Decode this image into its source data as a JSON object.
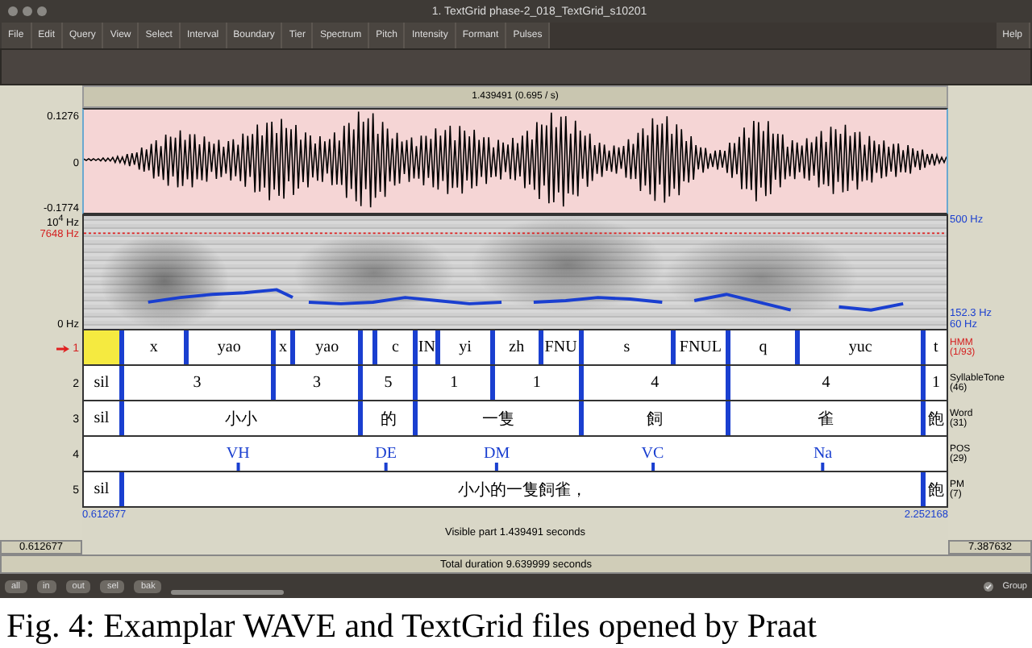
{
  "window": {
    "title": "1. TextGrid phase-2_018_TextGrid_s10201"
  },
  "menu": [
    "File",
    "Edit",
    "Query",
    "View",
    "Select",
    "Interval",
    "Boundary",
    "Tier",
    "Spectrum",
    "Pitch",
    "Intensity",
    "Formant",
    "Pulses"
  ],
  "help": "Help",
  "selection_duration": "1.439491 (0.695 / s)",
  "waveform": {
    "max": "0.1276",
    "zero": "0",
    "min": "-0.1774"
  },
  "spectrogram": {
    "top": "10$^{4}$ Hz",
    "cursor": "7648 Hz",
    "bottom": "0 Hz",
    "pitch_top": "500 Hz",
    "pitch_value": "152.3 Hz",
    "pitch_bottom": "60 Hz"
  },
  "tiers": [
    {
      "number": "1",
      "selected": true,
      "name": "HMM",
      "count": "(1/93)",
      "kind": "interval",
      "items": [
        {
          "selected": true
        },
        {
          "text": "x",
          "selected": false
        },
        {
          "text": "yao",
          "selected": false
        },
        {
          "text": "x",
          "selected": false
        },
        {
          "text": "yao",
          "selected": false
        },
        {
          "selected": false
        },
        {
          "text": "c",
          "selected": false
        },
        {
          "text": "IN",
          "selected": false
        },
        {
          "text": "yi",
          "selected": false
        },
        {
          "text": "zh",
          "selected": false
        },
        {
          "text": "FNU",
          "selected": false
        },
        {
          "text": "s",
          "selected": false
        },
        {
          "text": "FNUL",
          "selected": false
        },
        {
          "text": "q",
          "selected": false
        },
        {
          "text": "yuc",
          "selected": false
        },
        {
          "text": "t",
          "selected": false
        }
      ]
    },
    {
      "number": "2",
      "selected": false,
      "name": "SyllableTone",
      "count": "(46)",
      "kind": "interval",
      "items": [
        {
          "text": "sil"
        },
        {
          "text": "3"
        },
        {
          "text": "3"
        },
        {
          "text": "5"
        },
        {
          "text": "1"
        },
        {
          "text": "1"
        },
        {
          "text": "4"
        },
        {
          "text": "4"
        },
        {
          "text": "1"
        }
      ]
    },
    {
      "number": "3",
      "selected": false,
      "name": "Word",
      "count": "(31)",
      "kind": "interval",
      "items": [
        {
          "text": "sil"
        },
        {
          "text": "小小"
        },
        {
          "text": "的"
        },
        {
          "text": "一隻"
        },
        {
          "text": "飼"
        },
        {
          "text": "雀"
        },
        {
          "text": "飽"
        }
      ]
    },
    {
      "number": "4",
      "selected": false,
      "name": "POS",
      "count": "(29)",
      "kind": "point",
      "items": [
        {
          "text": "VH"
        },
        {
          "text": "DE"
        },
        {
          "text": "DM"
        },
        {
          "text": "VC"
        },
        {
          "text": "Na"
        }
      ]
    },
    {
      "number": "5",
      "selected": false,
      "name": "PM",
      "count": "(7)",
      "kind": "interval",
      "items": [
        {
          "text": "sil"
        },
        {
          "text": "小小的一隻飼雀，"
        },
        {
          "text": "飽"
        }
      ]
    }
  ],
  "visible": {
    "window_start": "0.612677",
    "start": "0.612677",
    "label": "Visible part 1.439491 seconds",
    "end": "2.252168",
    "window_end": "7.387632"
  },
  "total": "Total duration 9.639999 seconds",
  "buttons": [
    "all",
    "in",
    "out",
    "sel",
    "bak"
  ],
  "group": {
    "label": "Group",
    "checked": true
  },
  "caption": "Fig. 4: Examplar WAVE and TextGrid files opened by Praat"
}
